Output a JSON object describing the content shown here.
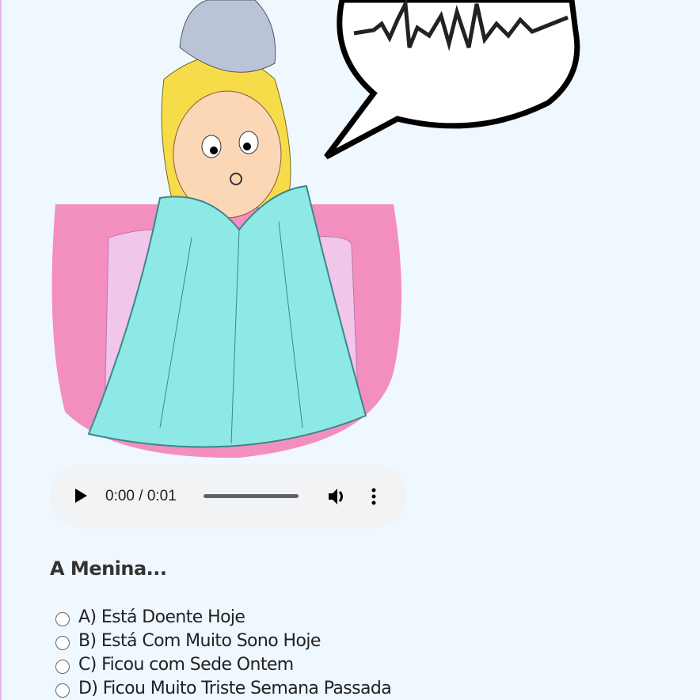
{
  "audio": {
    "time": "0:00 / 0:01",
    "progress": 0
  },
  "question": {
    "title": "A Menina...",
    "options": [
      {
        "label": "A) Está Doente Hoje"
      },
      {
        "label": "B) Está Com Muito Sono Hoje"
      },
      {
        "label": "C) Ficou com Sede Ontem"
      },
      {
        "label": "D) Ficou Muito Triste Semana Passada"
      }
    ]
  },
  "colors": {
    "background": "#eff7ff",
    "blanket": "#8ee8e6",
    "bed": "#f38fbf",
    "pillow": "#f2c6ea",
    "hair": "#f7dc4a"
  }
}
